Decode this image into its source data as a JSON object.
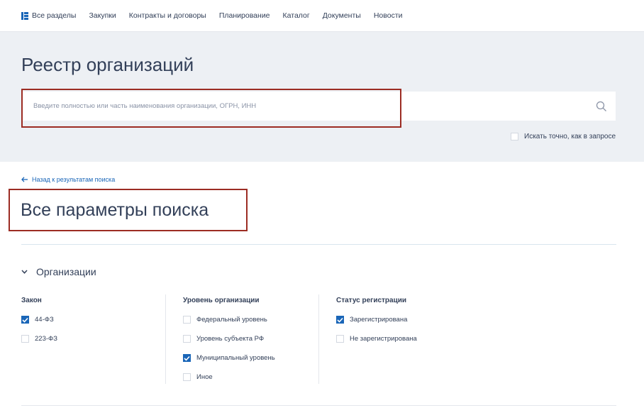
{
  "topnav": {
    "items": [
      {
        "label": "Все разделы",
        "icon": "sections-grid-icon"
      },
      {
        "label": "Закупки"
      },
      {
        "label": "Контракты и договоры"
      },
      {
        "label": "Планирование"
      },
      {
        "label": "Каталог"
      },
      {
        "label": "Документы"
      },
      {
        "label": "Новости"
      }
    ]
  },
  "registry": {
    "title": "Реестр организаций",
    "search": {
      "value": "",
      "placeholder": "Введите полностью или часть наименования организации, ОГРН, ИНН",
      "icon": "search-icon"
    },
    "exact_match": {
      "label": "Искать точно, как в запросе",
      "checked": false
    }
  },
  "back_link": {
    "label": "Назад к результатам поиска",
    "icon": "arrow-left-icon"
  },
  "params_title": "Все параметры поиска",
  "section": {
    "title": "Организации",
    "icon": "chevron-down-icon",
    "columns": [
      {
        "title": "Закон",
        "options": [
          {
            "label": "44-ФЗ",
            "checked": true
          },
          {
            "label": "223-ФЗ",
            "checked": false
          }
        ]
      },
      {
        "title": "Уровень организации",
        "options": [
          {
            "label": "Федеральный уровень",
            "checked": false
          },
          {
            "label": "Уровень субъекта РФ",
            "checked": false
          },
          {
            "label": "Муниципальный уровень",
            "checked": true
          },
          {
            "label": "Иное",
            "checked": false
          }
        ]
      },
      {
        "title": "Статус регистрации",
        "options": [
          {
            "label": "Зарегистрирована",
            "checked": true
          },
          {
            "label": "Не зарегистрирована",
            "checked": false
          }
        ]
      }
    ]
  },
  "colors": {
    "accent": "#1a66b8",
    "highlight": "#9c2c23",
    "text": "#334059",
    "hero_bg": "#edf0f4"
  }
}
